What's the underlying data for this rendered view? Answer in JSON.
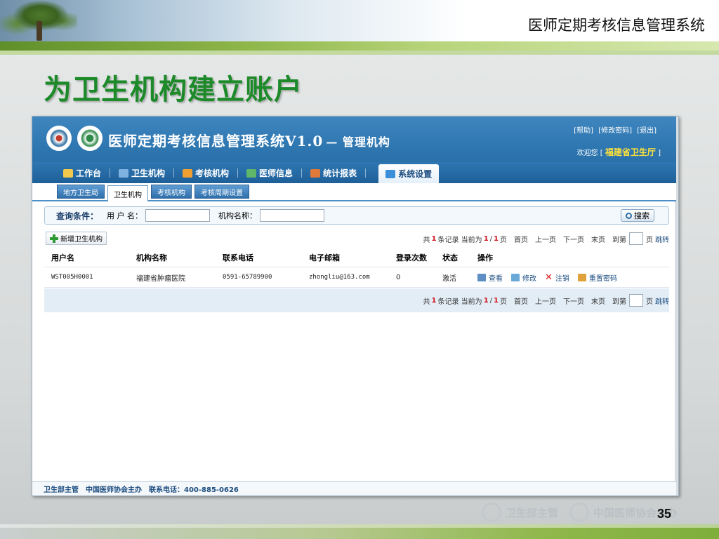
{
  "slide": {
    "system_title": "医师定期考核信息管理系统",
    "heading": "为卫生机构建立账户",
    "page_number": "35",
    "bottom_logo_1": "卫生部主管",
    "bottom_logo_2": "中国医师协会主办"
  },
  "app": {
    "title": "医师定期考核信息管理系统V1.0",
    "subtitle": "— 管理机构",
    "links": {
      "help": "[帮助]",
      "change_password": "[修改密码]",
      "logout": "[退出]"
    },
    "welcome_prefix": "欢迎您 [",
    "welcome_org": "福建省卫生厅",
    "welcome_suffix": "]",
    "nav": [
      {
        "label": "工作台",
        "icon_color": "#f2c94c"
      },
      {
        "label": "卫生机构",
        "icon_color": "#7fb2e0"
      },
      {
        "label": "考核机构",
        "icon_color": "#f0a030"
      },
      {
        "label": "医师信息",
        "icon_color": "#5fb86a"
      },
      {
        "label": "统计报表",
        "icon_color": "#e07a3a"
      },
      {
        "label": "系统设置",
        "icon_color": "#3a8fd8"
      }
    ],
    "subtabs": [
      "地方卫生局",
      "卫生机构",
      "考核机构",
      "考核周期设置"
    ],
    "search": {
      "label": "查询条件：",
      "user_label": "用 户 名：",
      "org_label": "机构名称：",
      "user_value": "",
      "org_value": "",
      "button": "搜索"
    },
    "add_button": "新增卫生机构",
    "pager": {
      "total_prefix": "共",
      "total": "1",
      "total_suffix": "条记录 当前为",
      "current": "1",
      "slash": "/",
      "pages": "1",
      "page_word": "页",
      "first": "首页",
      "prev": "上一页",
      "next": "下一页",
      "last": "末页",
      "goto": "到第",
      "page_unit": "页",
      "jump": "跳转"
    },
    "columns": [
      "用户名",
      "机构名称",
      "联系电话",
      "电子邮箱",
      "登录次数",
      "状态",
      "操作"
    ],
    "rows": [
      {
        "username": "WST005H0001",
        "org": "福建省肿瘤医院",
        "phone": "0591-65789900",
        "email": "zhongliu@163.com",
        "logins": "0",
        "status": "激活"
      }
    ],
    "ops": {
      "view": "查看",
      "edit": "修改",
      "cancel": "注销",
      "reset": "重置密码"
    },
    "footer": {
      "a": "卫生部主管",
      "b": "中国医师协会主办",
      "c": "联系电话：400-885-0626"
    }
  }
}
